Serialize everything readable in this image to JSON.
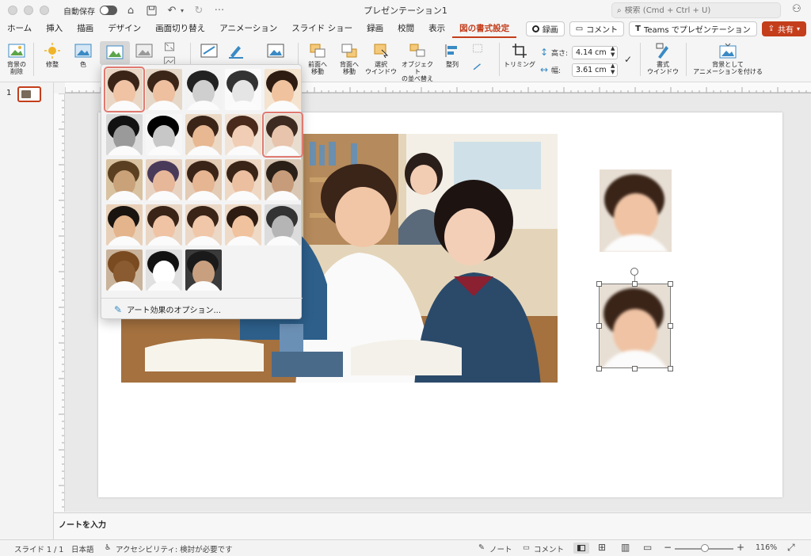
{
  "titlebar": {
    "autosave_label": "自動保存",
    "doc_title": "プレゼンテーション1",
    "search_placeholder": "検索 (Cmd + Ctrl + U)"
  },
  "tabs": [
    {
      "label": "ホーム"
    },
    {
      "label": "挿入"
    },
    {
      "label": "描画"
    },
    {
      "label": "デザイン"
    },
    {
      "label": "画面切り替え"
    },
    {
      "label": "アニメーション"
    },
    {
      "label": "スライド ショー"
    },
    {
      "label": "録画"
    },
    {
      "label": "校閲"
    },
    {
      "label": "表示"
    },
    {
      "label": "図の書式設定"
    }
  ],
  "tab_right": {
    "record": "録画",
    "comment": "コメント",
    "teams": "Teams でプレゼンテーション",
    "share": "共有"
  },
  "ribbon": {
    "remove_bg_l1": "背景の",
    "remove_bg_l2": "削除",
    "corrections": "修整",
    "color": "色",
    "bring_forward_l1": "前面へ",
    "bring_forward_l2": "移動",
    "send_backward_l1": "背面へ",
    "send_backward_l2": "移動",
    "selection_pane_l1": "選択",
    "selection_pane_l2": "ウインドウ",
    "arrange_objects_l1": "オブジェクト",
    "arrange_objects_l2": "の並べ替え",
    "align": "整列",
    "crop": "トリミング",
    "height_label": "高さ:",
    "height_value": "4.14 cm",
    "width_label": "幅:",
    "width_value": "3.61 cm",
    "format_pane_l1": "書式",
    "format_pane_l2": "ウインドウ",
    "animate_bg_l1": "背景として",
    "animate_bg_l2": "アニメーションを付ける"
  },
  "slides_panel": {
    "slide_number": "1"
  },
  "gallery": {
    "options_label": "アート効果のオプション...",
    "selected_index": 0,
    "hovered_index": 9,
    "effect_count": 23
  },
  "notes": {
    "placeholder": "ノートを入力"
  },
  "status": {
    "slide_info": "スライド 1 / 1",
    "language": "日本語",
    "accessibility": "アクセシビリティ: 検討が必要です",
    "notes_btn": "ノート",
    "comments_btn": "コメント",
    "zoom": "116%"
  }
}
